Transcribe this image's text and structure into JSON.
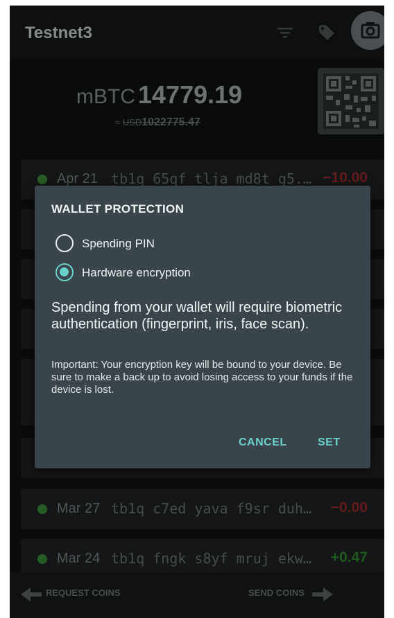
{
  "appbar": {
    "title": "Testnet3",
    "icons": [
      "filter-icon",
      "tag-icon",
      "more-vert-icon"
    ]
  },
  "balance": {
    "unit": "mBTC",
    "amount": "14779.19",
    "fiat_prefix": "≈",
    "fiat_unit": "USD",
    "fiat_amount": "1022775.47"
  },
  "transactions": [
    {
      "date": "Apr 21",
      "address": "tb1q 65qf tlja md8t g5...",
      "amount": "−10.00",
      "sign": "negative"
    },
    {
      "date": "Mar 27",
      "address": "tb1q c7ed yava f9sr duh...",
      "amount": "−0.00",
      "sign": "negative"
    },
    {
      "date": "Mar 24",
      "address": "tb1q fngk s8yf mruj ekw...",
      "amount": "+0.47",
      "sign": "positive"
    }
  ],
  "dialog": {
    "title": "WALLET PROTECTION",
    "options": [
      {
        "label": "Spending PIN",
        "checked": false
      },
      {
        "label": "Hardware encryption",
        "checked": true
      }
    ],
    "message": "Spending from your wallet will require biometric authentication (fingerprint, iris, face scan).",
    "note": "Important: Your encryption key will be bound to your device. Be sure to make a back up to avoid losing access to your funds if the device is lost.",
    "cancel_label": "CANCEL",
    "set_label": "SET"
  },
  "bottombar": {
    "request_label": "REQUEST COINS",
    "send_label": "SEND COINS"
  },
  "colors": {
    "accent": "#6ad2ca",
    "negative": "#9b2a2a",
    "positive": "#2f8a2f",
    "dialog_bg": "#39444b"
  }
}
